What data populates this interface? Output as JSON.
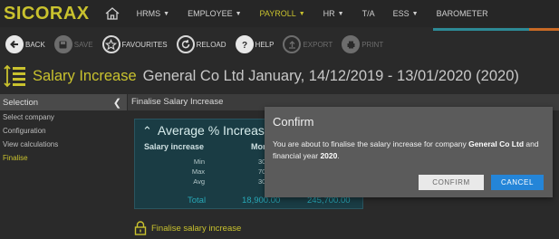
{
  "app": {
    "logo": "SICORAX"
  },
  "nav": {
    "items": [
      {
        "label": "HRMS",
        "has_caret": true
      },
      {
        "label": "EMPLOYEE",
        "has_caret": true
      },
      {
        "label": "PAYROLL",
        "has_caret": true,
        "active": true
      },
      {
        "label": "HR",
        "has_caret": true
      },
      {
        "label": "T/A",
        "has_caret": false
      },
      {
        "label": "ESS",
        "has_caret": true
      },
      {
        "label": "BAROMETER",
        "has_caret": false
      }
    ]
  },
  "toolbar": {
    "back": "BACK",
    "save": "SAVE",
    "favourites": "FAVOURITES",
    "reload": "RELOAD",
    "help": "HELP",
    "export": "EXPORT",
    "print": "PRINT"
  },
  "title": {
    "main": "Salary Increase",
    "sub": "General Co Ltd January, 14/12/2019 - 13/01/2020 (2020)"
  },
  "sidebar": {
    "header": "Selection",
    "items": [
      {
        "label": "Select company"
      },
      {
        "label": "Configuration"
      },
      {
        "label": "View calculations"
      },
      {
        "label": "Finalise",
        "active": true
      }
    ]
  },
  "main": {
    "header": "Finalise Salary Increase",
    "card": {
      "title": "Average % Increase",
      "col1": "Salary increase",
      "col2": "Mon",
      "rows": [
        {
          "label": "Min",
          "value": "30"
        },
        {
          "label": "Max",
          "value": "70"
        },
        {
          "label": "Avg",
          "value": "30"
        }
      ],
      "total_label": "Total",
      "total_value1": "18,900.00",
      "total_value2": "245,700.00"
    },
    "finalise_link": "Finalise salary increase"
  },
  "modal": {
    "title": "Confirm",
    "text_1": "You are about to finalise the salary increase for company ",
    "company": "General Co Ltd",
    "text_2": " and financial year ",
    "year": "2020",
    "text_3": ".",
    "confirm": "CONFIRM",
    "cancel": "CANCEL"
  },
  "colors": {
    "brand": "#c9c22e",
    "accent_teal": "#2d8a96",
    "accent_orange": "#c96a25",
    "card_bg": "#1a3c44",
    "cancel_blue": "#2485d8"
  }
}
